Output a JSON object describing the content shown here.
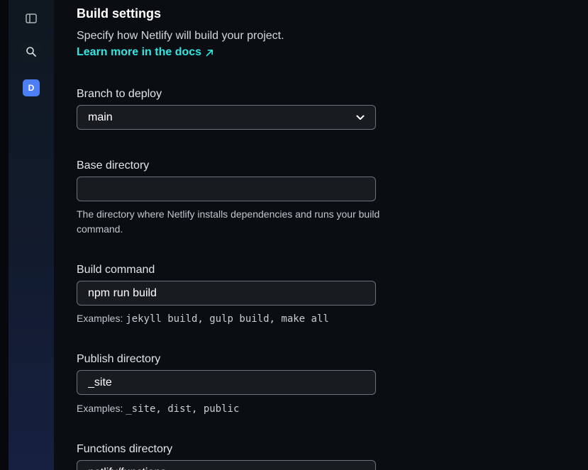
{
  "sidebar": {
    "toggle_icon": "sidebar-toggle-icon",
    "search_icon": "search-icon",
    "avatar_letter": "D",
    "avatar_color": "#4c7ef5"
  },
  "build_settings": {
    "title": "Build settings",
    "description": "Specify how Netlify will build your project.",
    "docs_link": "Learn more in the docs",
    "accent_color": "#32e6e2"
  },
  "branch": {
    "label": "Branch to deploy",
    "value": "main"
  },
  "base_directory": {
    "label": "Base directory",
    "value": "",
    "help": "The directory where Netlify installs dependencies and runs your build command."
  },
  "build_command": {
    "label": "Build command",
    "value": "npm run build",
    "help_prefix": "Examples: ",
    "help_examples": "jekyll build, gulp build, make all"
  },
  "publish_directory": {
    "label": "Publish directory",
    "value": "_site",
    "help_prefix": "Examples: ",
    "help_examples": "_site, dist, public"
  },
  "functions_directory": {
    "label": "Functions directory",
    "value": "netlify/functions"
  }
}
